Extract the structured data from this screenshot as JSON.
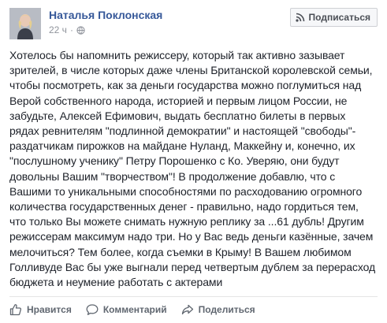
{
  "post": {
    "author": "Наталья Поклонская",
    "time": "22 ч",
    "dot": "·",
    "subscribe_label": "Подписаться",
    "body_lines": [
      "Хотелось бы напомнить режиссеру, который так активно зазывает",
      "зрителей, в числе которых даже члены Британской королевской семьи,",
      "чтобы посмотреть, как за деньги государства можно поглумиться над",
      "Верой собственного народа, историей и первым лицом России, не",
      "забудьте, Алексей Ефимович, выдать бесплатно билеты в первых",
      "рядах ревнителям \"подлинной демократии\" и настоящей \"свободы\"-",
      "раздатчикам пирожков на майдане Нуланд, Маккейну и, конечно, их",
      "\"послушному ученику\" Петру Порошенко с Ко. Уверяю, они будут",
      "довольны Вашим \"творчеством\"! В продолжение добавлю, что с",
      "Вашими то уникальными способностями по расходованию огромного",
      "количества государственных денег - правильно, надо гордиться тем,",
      "что только Вы можете снимать нужную реплику за ...61 дубль! Другим",
      "режиссерам максимум надо три. Но у Вас ведь деньги казённые, зачем",
      "мелочиться? Тем более, когда съемки в Крыму! В Вашем любимом",
      "Голливуде Вас бы уже выгнали перед четвертым дублем за перерасход",
      "бюджета и неумение работать с актерами"
    ],
    "actions": {
      "like_label": "Нравится",
      "comment_label": "Комментарий",
      "share_label": "Поделиться"
    }
  },
  "colors": {
    "link": "#365899",
    "text": "#1d2129",
    "meta": "#90949c",
    "action": "#606770"
  },
  "icons": {
    "avatar": "profile-photo",
    "audience": "globe-icon",
    "subscribe": "rss-icon",
    "like": "thumbs-up-icon",
    "comment": "speech-bubble-icon",
    "share": "share-arrow-icon"
  }
}
